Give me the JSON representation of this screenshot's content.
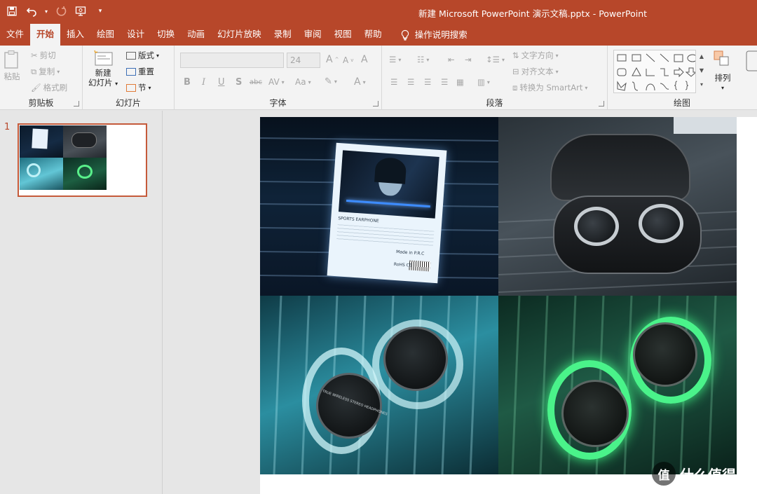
{
  "window": {
    "title": "新建 Microsoft PowerPoint 演示文稿.pptx  -  PowerPoint",
    "quick_access": [
      "save-icon",
      "undo-icon",
      "redo-icon",
      "present-icon",
      "customize-icon"
    ]
  },
  "tabs": [
    {
      "label": "文件"
    },
    {
      "label": "开始",
      "active": true
    },
    {
      "label": "插入"
    },
    {
      "label": "绘图"
    },
    {
      "label": "设计"
    },
    {
      "label": "切换"
    },
    {
      "label": "动画"
    },
    {
      "label": "幻灯片放映"
    },
    {
      "label": "录制"
    },
    {
      "label": "审阅"
    },
    {
      "label": "视图"
    },
    {
      "label": "帮助"
    }
  ],
  "search": {
    "label": "操作说明搜索"
  },
  "ribbon": {
    "clipboard": {
      "paste": "粘贴",
      "cut": "剪切",
      "copy": "复制",
      "format_painter": "格式刷",
      "label": "剪贴板"
    },
    "slides": {
      "new_slide_line1": "新建",
      "new_slide_line2": "幻灯片",
      "layout": "版式",
      "reset": "重置",
      "section": "节",
      "label": "幻灯片"
    },
    "font": {
      "font_name": "",
      "font_size": "24",
      "bold": "B",
      "italic": "I",
      "underline": "U",
      "shadow": "S",
      "strike": "abc",
      "spacing": "AV",
      "case": "Aa",
      "grow": "A",
      "shrink": "A",
      "clear": "A",
      "color": "A",
      "label": "字体"
    },
    "paragraph": {
      "text_direction": "文字方向",
      "align_text": "对齐文本",
      "smartart": "转换为 SmartArt",
      "label": "段落"
    },
    "drawing": {
      "arrange": "排列",
      "label": "绘图"
    }
  },
  "thumbs": {
    "slide_number": "1"
  },
  "watermark": {
    "logo": "值",
    "text": "什么值得买"
  },
  "photos": {
    "box_title": "SPORTS EARPHONE",
    "made_in": "Made in P.R.C",
    "rohs": "RoHS CE",
    "earbud_text": "TRUE WIRELESS STEREO HEADPHONES"
  }
}
